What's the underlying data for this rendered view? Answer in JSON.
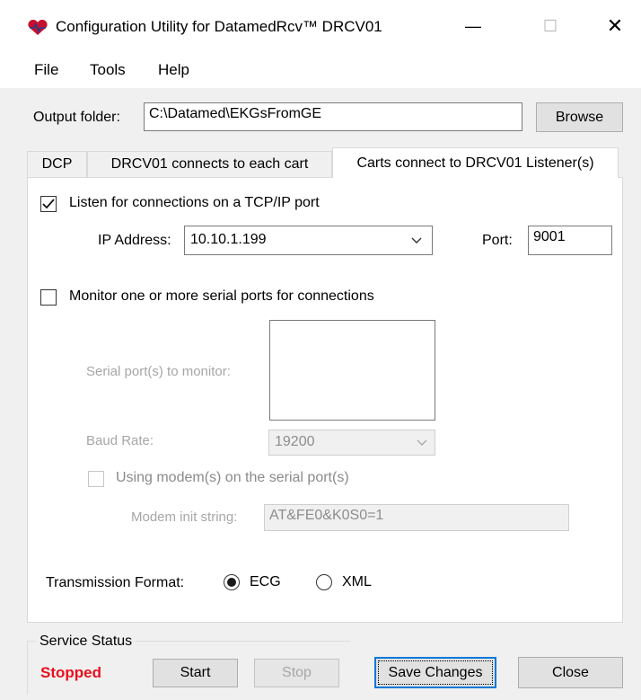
{
  "window": {
    "title": "Configuration Utility for DatamedRcv™ DRCV01",
    "controls": {
      "minimize": "—",
      "maximize": "☐",
      "close": "✕"
    }
  },
  "menu": [
    "File",
    "Tools",
    "Help"
  ],
  "output": {
    "label": "Output folder:",
    "value": "C:\\Datamed\\EKGsFromGE",
    "browse_label": "Browse"
  },
  "tabs": [
    {
      "label": "DCP",
      "active": false
    },
    {
      "label": "DRCV01 connects to each cart",
      "active": false
    },
    {
      "label": "Carts connect to DRCV01 Listener(s)",
      "active": true
    }
  ],
  "tcp": {
    "checkbox_label": "Listen for connections on a TCP/IP port",
    "checked": true,
    "ip_label": "IP Address:",
    "ip_value": "10.10.1.199",
    "port_label": "Port:",
    "port_value": "9001"
  },
  "serial": {
    "checkbox_label": "Monitor one or more serial ports for connections",
    "checked": false,
    "ports_label": "Serial port(s) to monitor:",
    "ports": [],
    "baud_label": "Baud Rate:",
    "baud_value": "19200",
    "modem_label": "Using modem(s) on the serial port(s)",
    "modem_checked": false,
    "init_label": "Modem init string:",
    "init_value": "AT&FE0&K0S0=1"
  },
  "format": {
    "label": "Transmission Format:",
    "options": [
      {
        "label": "ECG",
        "selected": true
      },
      {
        "label": "XML",
        "selected": false
      }
    ]
  },
  "service": {
    "group_label": "Service Status",
    "status": "Stopped",
    "status_color": "#e8101e",
    "start_label": "Start",
    "stop_label": "Stop"
  },
  "footer": {
    "save_label": "Save Changes",
    "close_label": "Close"
  }
}
